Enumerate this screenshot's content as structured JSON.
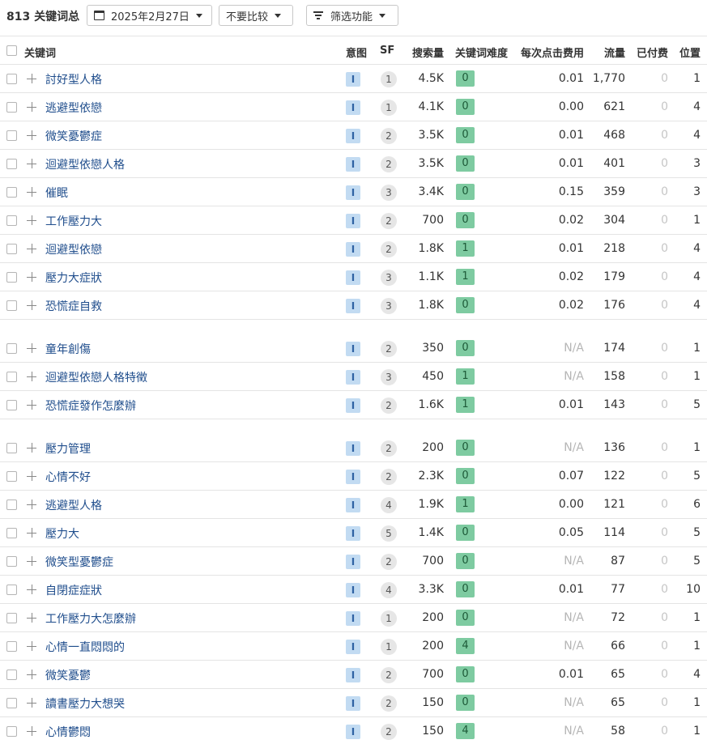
{
  "toolbar": {
    "count_label": "813 关键词总",
    "date_label": "2025年2月27日",
    "compare_label": "不要比较",
    "filter_label": "筛选功能"
  },
  "columns": {
    "keyword": "关键词",
    "intent": "意图",
    "sf": "SF",
    "volume": "搜索量",
    "kd": "关键词难度",
    "cpc": "每次点击费用",
    "traffic": "流量",
    "paid": "已付费",
    "position": "位置"
  },
  "colors": {
    "keyword_link": "#1f4d8c",
    "intent_badge_bg": "#c2dbf2",
    "kd_badge_bg": "#7ecba1",
    "na_text": "#b6b6b6"
  },
  "icons": [
    "calendar-icon",
    "chevron-down-icon",
    "filter-icon",
    "plus-icon",
    "checkbox"
  ],
  "rows": [
    {
      "keyword": "討好型人格",
      "intent": "I",
      "sf": "1",
      "volume": "4.5K",
      "kd": "0",
      "cpc": "0.01",
      "traffic": "1,770",
      "paid": "0",
      "position": "1"
    },
    {
      "keyword": "逃避型依戀",
      "intent": "I",
      "sf": "1",
      "volume": "4.1K",
      "kd": "0",
      "cpc": "0.00",
      "traffic": "621",
      "paid": "0",
      "position": "4"
    },
    {
      "keyword": "微笑憂鬱症",
      "intent": "I",
      "sf": "2",
      "volume": "3.5K",
      "kd": "0",
      "cpc": "0.01",
      "traffic": "468",
      "paid": "0",
      "position": "4"
    },
    {
      "keyword": "迴避型依戀人格",
      "intent": "I",
      "sf": "2",
      "volume": "3.5K",
      "kd": "0",
      "cpc": "0.01",
      "traffic": "401",
      "paid": "0",
      "position": "3"
    },
    {
      "keyword": "催眠",
      "intent": "I",
      "sf": "3",
      "volume": "3.4K",
      "kd": "0",
      "cpc": "0.15",
      "traffic": "359",
      "paid": "0",
      "position": "3"
    },
    {
      "keyword": "工作壓力大",
      "intent": "I",
      "sf": "2",
      "volume": "700",
      "kd": "0",
      "cpc": "0.02",
      "traffic": "304",
      "paid": "0",
      "position": "1"
    },
    {
      "keyword": "迴避型依戀",
      "intent": "I",
      "sf": "2",
      "volume": "1.8K",
      "kd": "1",
      "cpc": "0.01",
      "traffic": "218",
      "paid": "0",
      "position": "4"
    },
    {
      "keyword": "壓力大症狀",
      "intent": "I",
      "sf": "3",
      "volume": "1.1K",
      "kd": "1",
      "cpc": "0.02",
      "traffic": "179",
      "paid": "0",
      "position": "4"
    },
    {
      "keyword": "恐慌症自救",
      "intent": "I",
      "sf": "3",
      "volume": "1.8K",
      "kd": "0",
      "cpc": "0.02",
      "traffic": "176",
      "paid": "0",
      "position": "4"
    },
    {
      "keyword": "童年創傷",
      "intent": "I",
      "sf": "2",
      "volume": "350",
      "kd": "0",
      "cpc": "N/A",
      "traffic": "174",
      "paid": "0",
      "position": "1"
    },
    {
      "keyword": "迴避型依戀人格特徵",
      "intent": "I",
      "sf": "3",
      "volume": "450",
      "kd": "1",
      "cpc": "N/A",
      "traffic": "158",
      "paid": "0",
      "position": "1"
    },
    {
      "keyword": "恐慌症發作怎麼辦",
      "intent": "I",
      "sf": "2",
      "volume": "1.6K",
      "kd": "1",
      "cpc": "0.01",
      "traffic": "143",
      "paid": "0",
      "position": "5"
    },
    {
      "keyword": "壓力管理",
      "intent": "I",
      "sf": "2",
      "volume": "200",
      "kd": "0",
      "cpc": "N/A",
      "traffic": "136",
      "paid": "0",
      "position": "1"
    },
    {
      "keyword": "心情不好",
      "intent": "I",
      "sf": "2",
      "volume": "2.3K",
      "kd": "0",
      "cpc": "0.07",
      "traffic": "122",
      "paid": "0",
      "position": "5"
    },
    {
      "keyword": "逃避型人格",
      "intent": "I",
      "sf": "4",
      "volume": "1.9K",
      "kd": "1",
      "cpc": "0.00",
      "traffic": "121",
      "paid": "0",
      "position": "6"
    },
    {
      "keyword": "壓力大",
      "intent": "I",
      "sf": "5",
      "volume": "1.4K",
      "kd": "0",
      "cpc": "0.05",
      "traffic": "114",
      "paid": "0",
      "position": "5"
    },
    {
      "keyword": "微笑型憂鬱症",
      "intent": "I",
      "sf": "2",
      "volume": "700",
      "kd": "0",
      "cpc": "N/A",
      "traffic": "87",
      "paid": "0",
      "position": "5"
    },
    {
      "keyword": "自閉症症狀",
      "intent": "I",
      "sf": "4",
      "volume": "3.3K",
      "kd": "0",
      "cpc": "0.01",
      "traffic": "77",
      "paid": "0",
      "position": "10"
    },
    {
      "keyword": "工作壓力大怎麼辦",
      "intent": "I",
      "sf": "1",
      "volume": "200",
      "kd": "0",
      "cpc": "N/A",
      "traffic": "72",
      "paid": "0",
      "position": "1"
    },
    {
      "keyword": "心情一直悶悶的",
      "intent": "I",
      "sf": "1",
      "volume": "200",
      "kd": "4",
      "cpc": "N/A",
      "traffic": "66",
      "paid": "0",
      "position": "1"
    },
    {
      "keyword": "微笑憂鬱",
      "intent": "I",
      "sf": "2",
      "volume": "700",
      "kd": "0",
      "cpc": "0.01",
      "traffic": "65",
      "paid": "0",
      "position": "4"
    },
    {
      "keyword": "讀書壓力大想哭",
      "intent": "I",
      "sf": "2",
      "volume": "150",
      "kd": "0",
      "cpc": "N/A",
      "traffic": "65",
      "paid": "0",
      "position": "1"
    },
    {
      "keyword": "心情鬱悶",
      "intent": "I",
      "sf": "2",
      "volume": "150",
      "kd": "4",
      "cpc": "N/A",
      "traffic": "58",
      "paid": "0",
      "position": "1"
    }
  ]
}
